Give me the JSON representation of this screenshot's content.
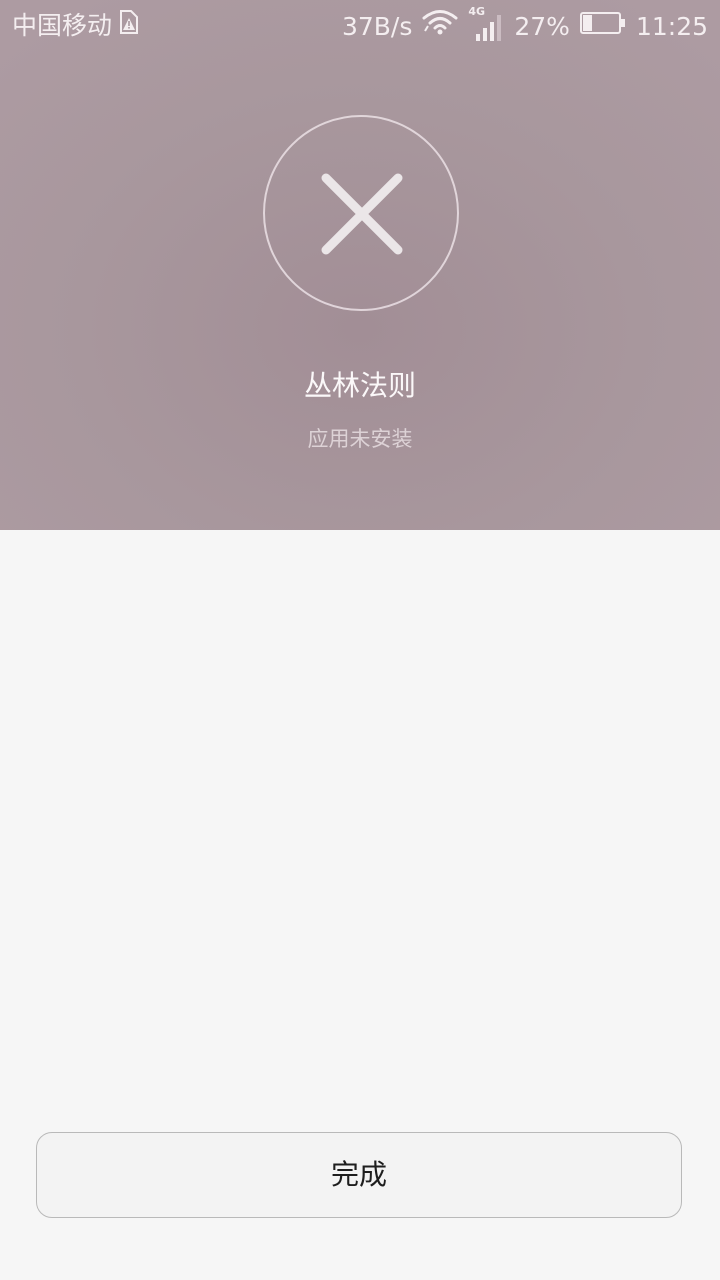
{
  "status_bar": {
    "carrier": "中国移动",
    "net_speed": "37B/s",
    "network_type": "4G",
    "battery_percent": "27%",
    "battery_level": 0.27,
    "time": "11:25",
    "icons": [
      "sim-warning-icon",
      "wifi-icon",
      "signal-icon",
      "battery-icon"
    ]
  },
  "result": {
    "icon": "close-icon",
    "app_name": "丛林法则",
    "status": "应用未安装"
  },
  "footer": {
    "done_label": "完成"
  },
  "colors": {
    "header_bg": "#a8979d",
    "page_bg": "#f6f6f6",
    "button_bg": "#f3f3f3"
  }
}
